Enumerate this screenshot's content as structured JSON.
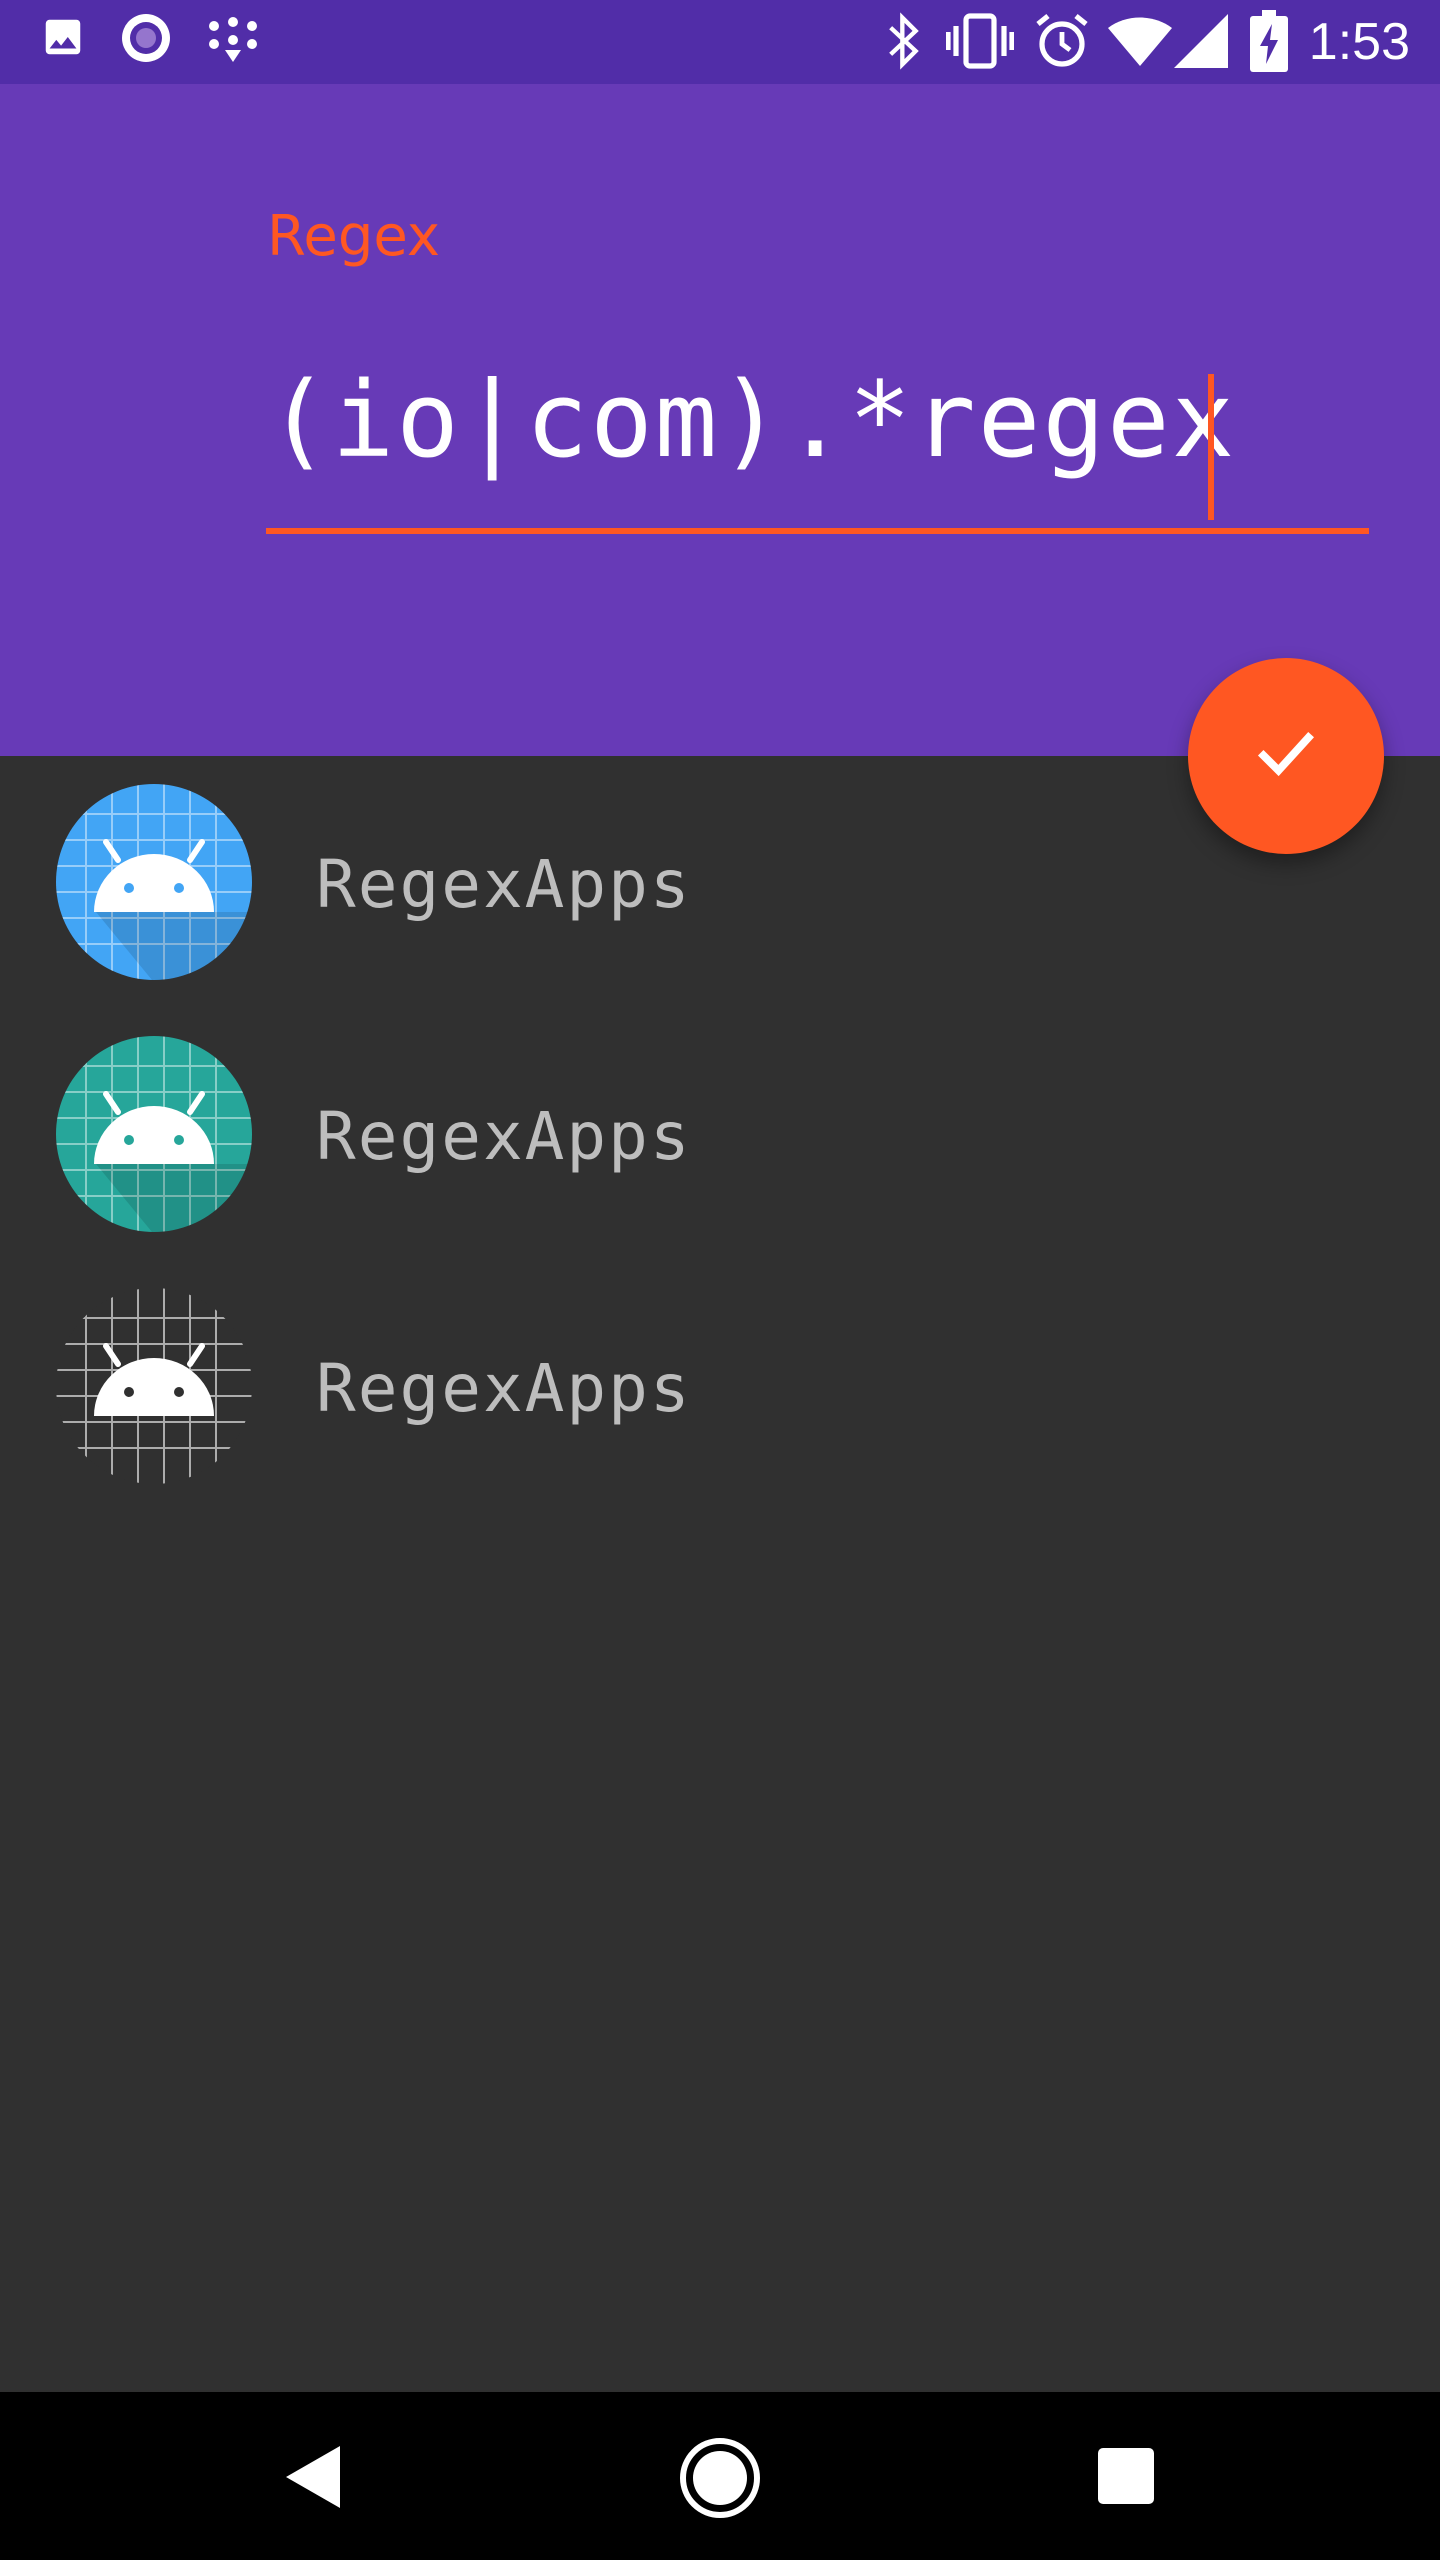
{
  "status_bar": {
    "time": "1:53",
    "left_icons": [
      "image-icon",
      "circle-app-icon",
      "dots-app-icon"
    ],
    "right_icons": [
      "bluetooth-icon",
      "vibrate-icon",
      "alarm-icon",
      "wifi-icon",
      "signal-icon",
      "battery-charging-icon"
    ]
  },
  "regex_input": {
    "label": "Regex",
    "value": "(io|com).*regex"
  },
  "fab": {
    "icon": "check-icon"
  },
  "apps": [
    {
      "label": "RegexApps",
      "icon": "android-icon",
      "icon_bg": "#42A5F5"
    },
    {
      "label": "RegexApps",
      "icon": "android-icon",
      "icon_bg": "#26A69A"
    },
    {
      "label": "RegexApps",
      "icon": "android-icon",
      "icon_bg": "#303030"
    }
  ],
  "nav_bar": {
    "icons": [
      "back-icon",
      "home-icon",
      "recents-icon"
    ]
  },
  "colors": {
    "status_bar": "#512DA8",
    "primary": "#673AB7",
    "accent": "#FF5722",
    "background": "#303030",
    "list_text": "#BDBDBD"
  }
}
